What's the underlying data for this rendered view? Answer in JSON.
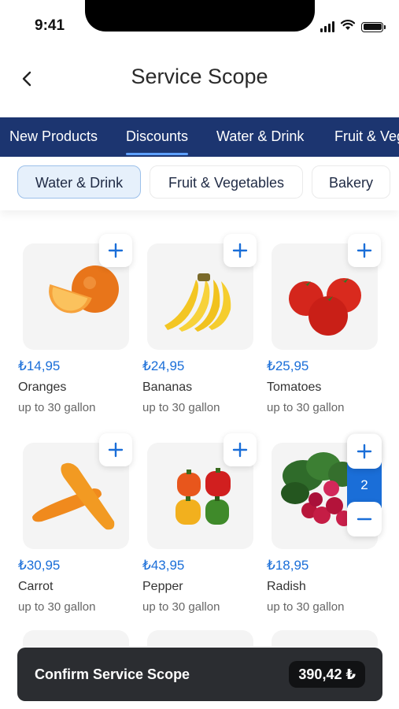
{
  "status_bar": {
    "time": "9:41"
  },
  "header": {
    "title": "Service Scope"
  },
  "category_tabs": [
    {
      "label": "New Products"
    },
    {
      "label": "Discounts"
    },
    {
      "label": "Water & Drink"
    },
    {
      "label": "Fruit & Vegetables"
    }
  ],
  "active_category": "Discounts",
  "sub_categories": [
    {
      "label": "Water & Drink"
    },
    {
      "label": "Fruit & Vegetables"
    },
    {
      "label": "Bakery"
    }
  ],
  "active_sub_category": "Water & Drink",
  "products": [
    {
      "price": "₺14,95",
      "name": "Oranges",
      "unit": "up to 30 gallon"
    },
    {
      "price": "₺24,95",
      "name": "Bananas",
      "unit": "up to 30 gallon"
    },
    {
      "price": "₺25,95",
      "name": "Tomatoes",
      "unit": "up to 30 gallon"
    },
    {
      "price": "₺30,95",
      "name": "Carrot",
      "unit": "up to 30 gallon"
    },
    {
      "price": "₺43,95",
      "name": "Pepper",
      "unit": "up to 30 gallon"
    },
    {
      "price": "₺18,95",
      "name": "Radish",
      "unit": "up to 30 gallon"
    }
  ],
  "stepper": {
    "quantity": "2"
  },
  "confirm": {
    "label": "Confirm Service Scope",
    "total": "390,42 ₺"
  },
  "colors": {
    "nav_background": "#1c3570",
    "accent_blue": "#1a6ed8",
    "confirm_background": "#2b2d31"
  }
}
